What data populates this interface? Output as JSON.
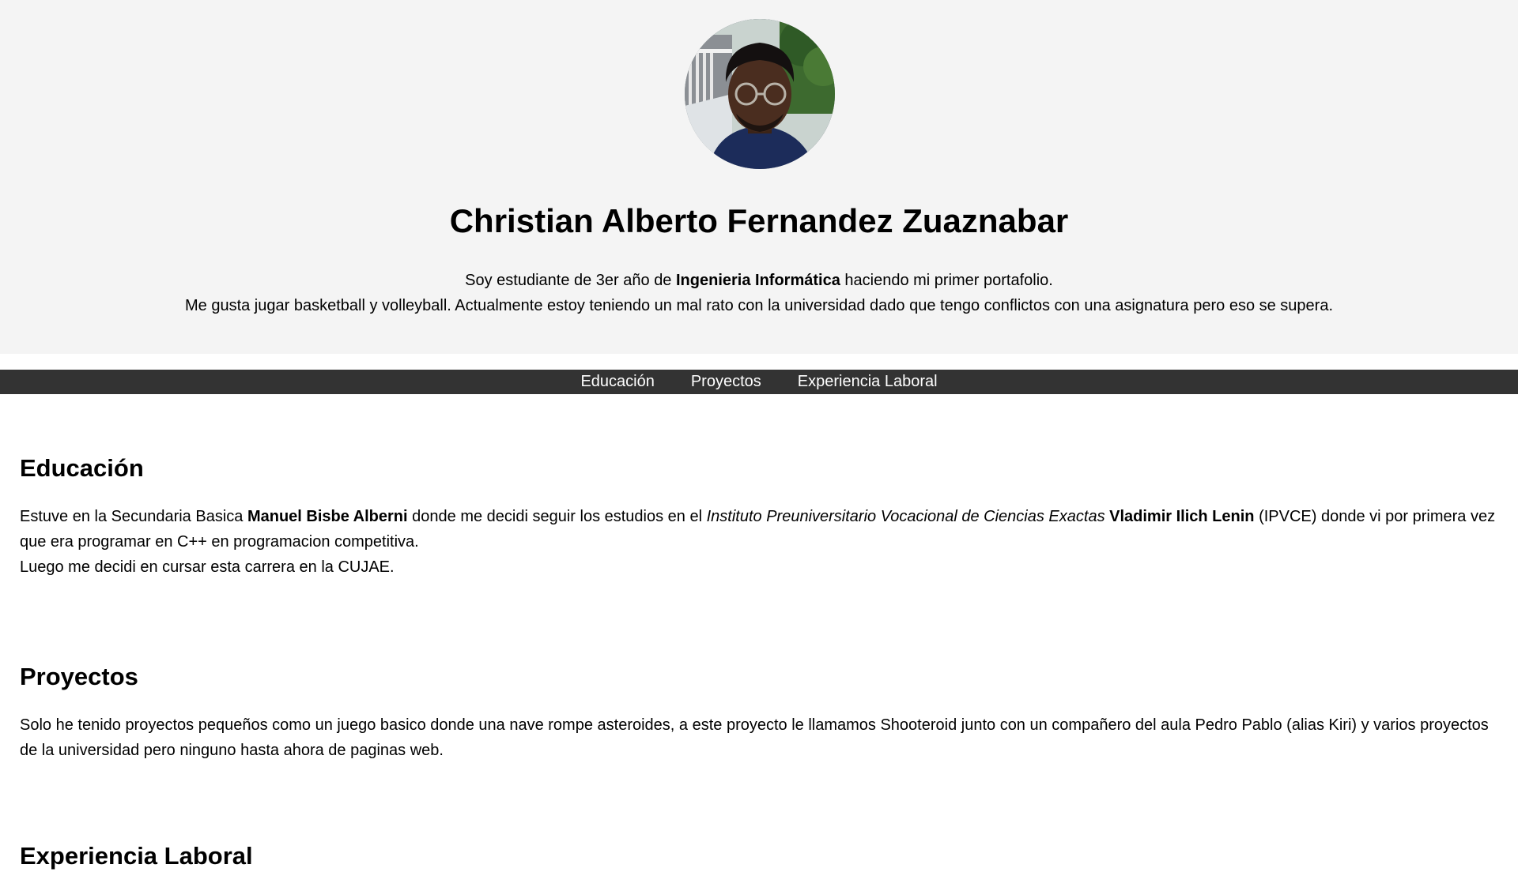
{
  "profile": {
    "name": "Christian Alberto Fernandez Zuaznabar",
    "avatar_icon": "profile-photo",
    "bio_line1_a": "Soy estudiante de 3er año de ",
    "bio_line1_bold": "Ingenieria Informática",
    "bio_line1_b": " haciendo mi primer portafolio.",
    "bio_line2": "Me gusta jugar basketball y volleyball. Actualmente estoy teniendo un mal rato con la universidad dado que tengo conflictos con una asignatura pero eso se supera."
  },
  "nav": {
    "items": [
      {
        "label": "Educación"
      },
      {
        "label": "Proyectos"
      },
      {
        "label": "Experiencia Laboral"
      }
    ]
  },
  "education": {
    "title": "Educación",
    "p1_a": "Estuve en la Secundaria Basica ",
    "p1_bold1": "Manuel Bisbe Alberni",
    "p1_b": " donde me decidi seguir los estudios en el ",
    "p1_italic": "Instituto Preuniversitario Vocacional de Ciencias Exactas",
    "p1_c": " ",
    "p1_bold2": "Vladimir Ilich Lenin",
    "p1_d": " (IPVCE) donde vi por primera vez que era programar en C++ en programacion competitiva.",
    "p2": "Luego me decidi en cursar esta carrera en la CUJAE."
  },
  "projects": {
    "title": "Proyectos",
    "text": "Solo he tenido proyectos pequeños como un juego basico donde una nave rompe asteroides, a este proyecto le llamamos Shooteroid junto con un compañero del aula Pedro Pablo (alias Kiri) y varios proyectos de la universidad pero ninguno hasta ahora de paginas web."
  },
  "experience": {
    "title": "Experiencia Laboral"
  },
  "colors": {
    "header_bg": "#f4f4f4",
    "nav_bg": "#333333",
    "nav_text": "#ffffff"
  }
}
